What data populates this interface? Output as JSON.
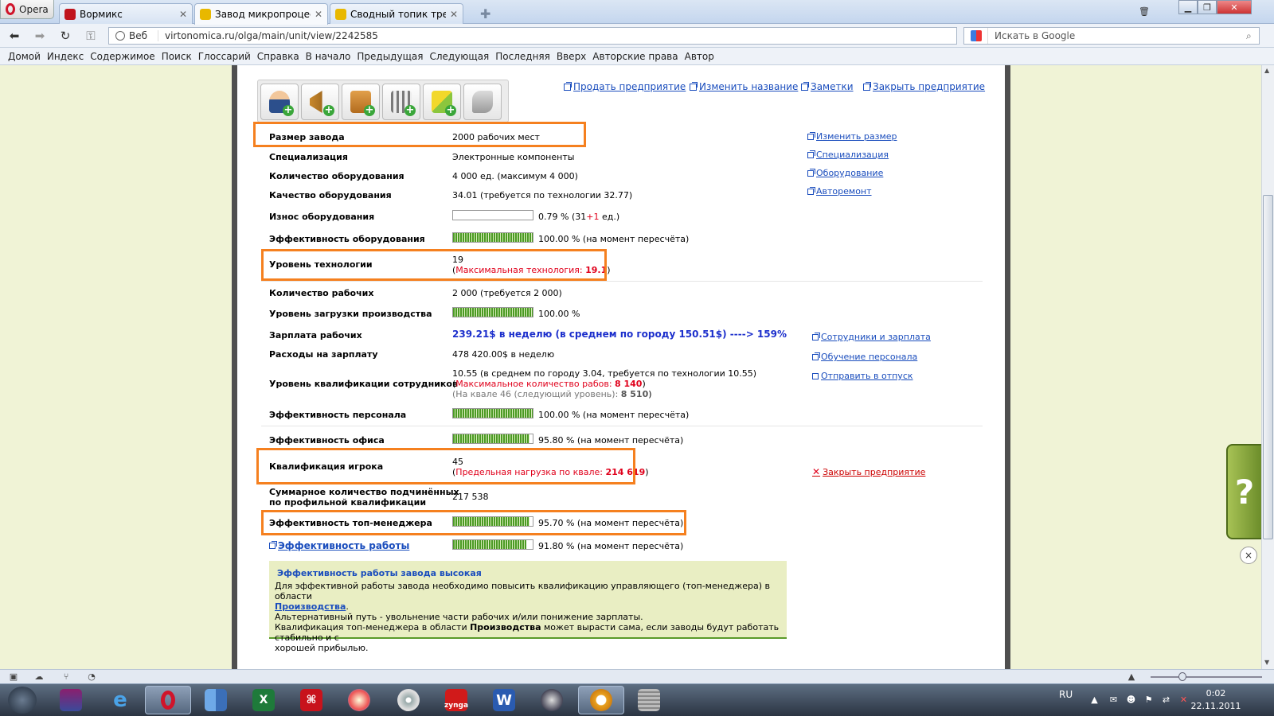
{
  "browser": {
    "opera_label": "Opera",
    "tabs": [
      {
        "title": "Вормикс",
        "active": false
      },
      {
        "title": "Завод микропроцесс...",
        "active": true
      },
      {
        "title": "Сводный топик требо...",
        "active": false
      }
    ],
    "address": {
      "mode_label": "Веб",
      "url": "virtonomica.ru/olga/main/unit/view/2242585"
    },
    "search_placeholder": "Искать в Google",
    "link_bar": [
      "Домой",
      "Индекс",
      "Содержимое",
      "Поиск",
      "Глоссарий",
      "Справка",
      "В начало",
      "Предыдущая",
      "Следующая",
      "Последняя",
      "Вверх",
      "Авторские права",
      "Автор"
    ]
  },
  "unit": {
    "top_links": [
      "Продать предприятие",
      "Изменить название",
      "Заметки",
      "Закрыть предприятие"
    ],
    "toolbar_icons": [
      "hire-employee-icon",
      "advertising-icon",
      "supply-icon",
      "equipment-icon",
      "product-icon",
      "deal-icon"
    ],
    "size": {
      "label": "Размер завода",
      "value": "2000 рабочих мест"
    },
    "specialization": {
      "label": "Специализация",
      "value": "Электронные компоненты"
    },
    "equipment_count": {
      "label": "Количество оборудования",
      "value": "4 000 ед. (максимум 4 000)"
    },
    "equipment_quality": {
      "label": "Качество оборудования",
      "value": "34.01 (требуется по технологии 32.77)"
    },
    "equipment_wear": {
      "label": "Износ оборудования",
      "value_prefix": "0.79 % (31",
      "value_red": "+1",
      "value_suffix": " ед.)",
      "bar_percent": 0
    },
    "equipment_efficiency": {
      "label": "Эффективность оборудования",
      "value": "100.00 % (на момент пересчёта)",
      "bar_percent": 100
    },
    "tech_level": {
      "label": "Уровень технологии",
      "value": "19",
      "max_label_open": "(",
      "max_label": "Максимальная технология: ",
      "max_value": "19.1",
      "max_label_close": ")"
    },
    "workers": {
      "label": "Количество рабочих",
      "value": "2 000 (требуется 2 000)"
    },
    "load": {
      "label": "Уровень загрузки производства",
      "value": "100.00 %",
      "bar_percent": 100
    },
    "salary": {
      "label": "Зарплата рабочих",
      "value": "239.21$ в неделю (в среднем по городу 150.51$) ----> 159%"
    },
    "salary_costs": {
      "label": "Расходы на зарплату",
      "value": "478 420.00$ в неделю"
    },
    "qualification": {
      "label": "Уровень квалификации сотрудников",
      "line1": "10.55 (в среднем по городу 3.04, требуется по технологии 10.55)",
      "line2_open": "(",
      "line2_label": "Максимальное количество рабов: ",
      "line2_value": "8 140",
      "line2_close": ")",
      "line3_label": "(На квале 46 (следующий уровень): ",
      "line3_value": "8 510",
      "line3_close": ")"
    },
    "staff_efficiency": {
      "label": "Эффективность персонала",
      "value": "100.00 % (на момент пересчёта)",
      "bar_percent": 100
    },
    "office_efficiency": {
      "label": "Эффективность офиса",
      "value": "95.80 % (на момент пересчёта)",
      "bar_percent": 95.8
    },
    "player_qualification": {
      "label": "Квалификация игрока",
      "value": "45",
      "limit_open": "(",
      "limit_label": "Предельная нагрузка по квале: ",
      "limit_value": "214 619",
      "limit_close": ")"
    },
    "subordinates": {
      "label_line1": "Суммарное количество подчинённых",
      "label_line2": "по профильной квалификации",
      "value": "217 538"
    },
    "top_manager_efficiency": {
      "label": "Эффективность топ-менеджера",
      "value": "95.70 % (на момент пересчёта)",
      "bar_percent": 95.7
    },
    "work_efficiency": {
      "label": "Эффективность работы",
      "value": "91.80 % (на момент пересчёта)",
      "bar_percent": 91.8
    },
    "side_links": {
      "equipment": [
        "Изменить размер",
        "Специализация",
        "Оборудование",
        "Авторемонт"
      ],
      "staff": [
        "Сотрудники и зарплата",
        "Обучение персонала",
        "Отправить в отпуск"
      ],
      "close": "Закрыть предприятие"
    },
    "info": {
      "title": "Эффективность работы завода высокая",
      "line1": "Для эффективной работы завода необходимо повысить квалификацию управляющего (топ-менеджера) в области",
      "line2_link": "Производства",
      "line2_tail": ".",
      "line3": "Альтернативный путь - увольнение части рабочих и/или понижение зарплаты.",
      "line4_a": "Квалификация топ-менеджера в области ",
      "line4_bold": "Производства",
      "line4_b": " может вырасти сама, если заводы будут работать стабильно и с",
      "line5": "хорошей прибылью."
    },
    "help_glyph": "?",
    "help_close": "×"
  },
  "taskbar": {
    "apps": [
      "winrar",
      "internet-explorer",
      "opera",
      "finder",
      "excel",
      "acrobat",
      "paint",
      "media-player",
      "zynga",
      "word",
      "safari",
      "mail",
      "calculator"
    ],
    "zynga_label": "zynga",
    "word_label": "W",
    "excel_label": "X",
    "language": "RU",
    "time": "0:02",
    "date": "22.11.2011"
  },
  "colors": {
    "highlight": "#f5801f",
    "link": "#1a4dbd",
    "alert": "#e0001b",
    "bar": "#4b9a24"
  }
}
